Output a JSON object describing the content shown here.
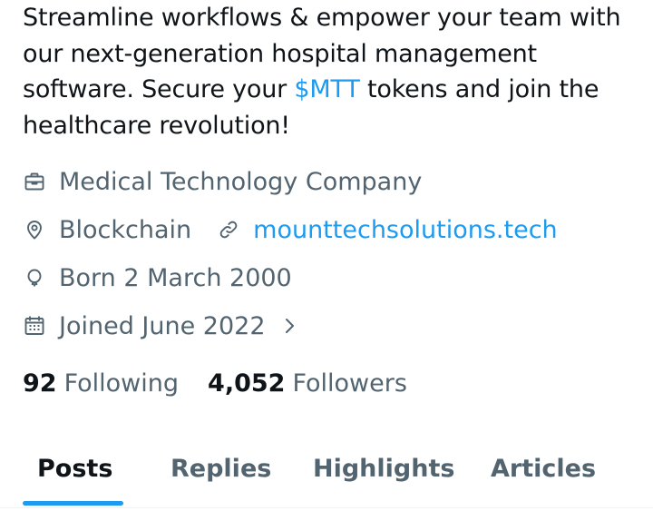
{
  "bio": {
    "text_before": "Streamline workflows & empower your team with our next-generation hospital management software. Secure your ",
    "cashtag": "$MTT",
    "text_after": " tokens and join the healthcare revolution!"
  },
  "profile_meta": {
    "category": {
      "icon": "briefcase-icon",
      "label": "Medical Technology Company"
    },
    "location": {
      "icon": "location-pin-icon",
      "label": "Blockchain"
    },
    "website": {
      "icon": "link-icon",
      "label": "mounttechsolutions.tech"
    },
    "birthday": {
      "icon": "balloon-icon",
      "label": "Born 2 March 2000"
    },
    "joined": {
      "icon": "calendar-icon",
      "label": "Joined June 2022",
      "expand_icon": "chevron-right-icon"
    }
  },
  "stats": {
    "following_count": "92",
    "following_label": "Following",
    "followers_count": "4,052",
    "followers_label": "Followers"
  },
  "tabs": [
    {
      "label": "Posts",
      "active": true
    },
    {
      "label": "Replies",
      "active": false
    },
    {
      "label": "Highlights",
      "active": false
    },
    {
      "label": "Articles",
      "active": false
    }
  ],
  "colors": {
    "accent": "#1d9bf0",
    "text_primary": "#0f1419",
    "text_secondary": "#536471"
  }
}
